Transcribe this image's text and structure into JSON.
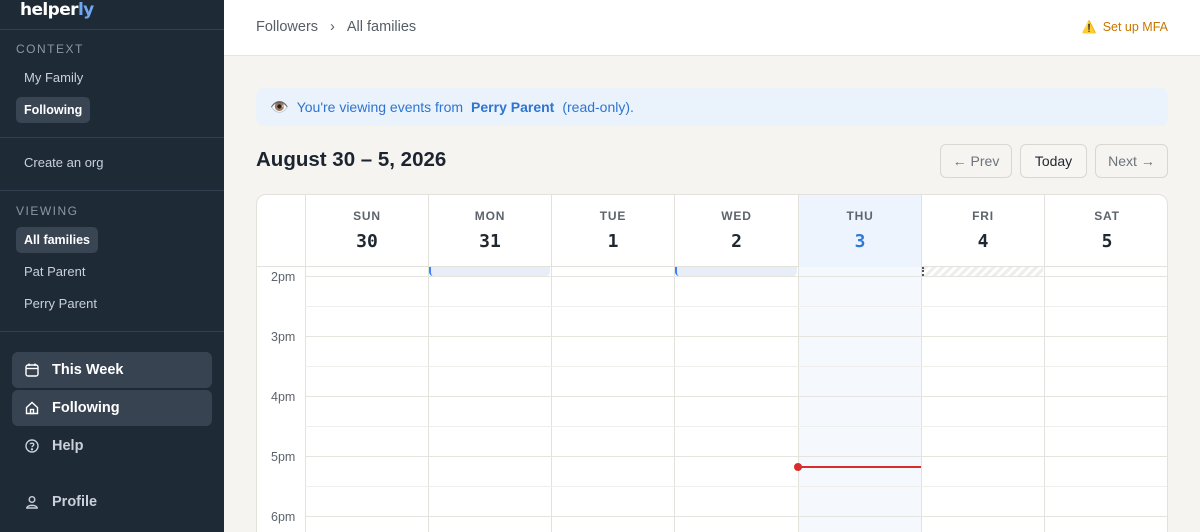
{
  "sidebar": {
    "logo_main": "helper",
    "logo_accent": "ly",
    "context_label": "CONTEXT",
    "context_items": [
      {
        "label": "My Family"
      },
      {
        "label": "Following"
      }
    ],
    "create_org": "Create an org",
    "viewing_label": "VIEWING",
    "viewing_items": [
      {
        "label": "All families"
      },
      {
        "label": "Pat Parent"
      },
      {
        "label": "Perry Parent"
      }
    ],
    "nav": [
      {
        "label": "This Week",
        "icon": "calendar-icon"
      },
      {
        "label": "Following",
        "icon": "home-icon"
      },
      {
        "label": "Help",
        "icon": "help-circle-icon"
      },
      {
        "label": "Profile",
        "icon": "user-icon"
      }
    ]
  },
  "topbar": {
    "breadcrumb": [
      "Followers",
      "All families"
    ],
    "separator": "›",
    "mfa_label": "Set up MFA",
    "mfa_icon": "⚠️"
  },
  "banner": {
    "icon": "👁️",
    "prefix": "You're viewing events from",
    "name": "Perry Parent",
    "suffix": "(read-only)."
  },
  "calendar": {
    "title": "August 30 – 5, 2026",
    "prev_label": "← Prev",
    "today_label": "Today",
    "next_label": "Next →",
    "days": [
      {
        "name": "SUN",
        "date": "30"
      },
      {
        "name": "MON",
        "date": "31"
      },
      {
        "name": "TUE",
        "date": "1"
      },
      {
        "name": "WED",
        "date": "2"
      },
      {
        "name": "THU",
        "date": "3"
      },
      {
        "name": "FRI",
        "date": "4"
      },
      {
        "name": "SAT",
        "date": "5"
      }
    ],
    "today_index": 4,
    "hours": [
      "2pm",
      "3pm",
      "4pm",
      "5pm",
      "6pm"
    ],
    "colors": {
      "accent": "#2f7ad8",
      "now_line": "#d92d2d",
      "warning": "#c77700",
      "sidebar_bg": "#1f2a37"
    }
  }
}
